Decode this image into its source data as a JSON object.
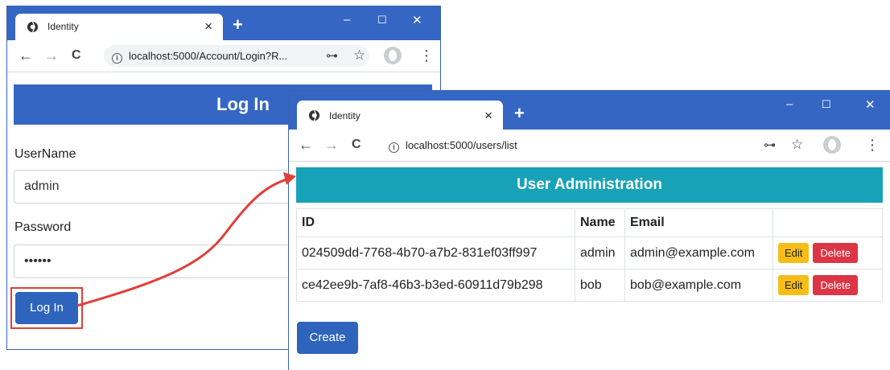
{
  "login_window": {
    "tab_title": "Identity",
    "tab_close": "×",
    "new_tab": "+",
    "address": "localhost:5000/Account/Login?R...",
    "header": "Log In",
    "username_label": "UserName",
    "username_value": "admin",
    "password_label": "Password",
    "password_value": "••••••",
    "login_button": "Log In"
  },
  "users_window": {
    "tab_title": "Identity",
    "tab_close": "×",
    "new_tab": "+",
    "address": "localhost:5000/users/list",
    "header": "User Administration",
    "table": {
      "columns": [
        "ID",
        "Name",
        "Email",
        ""
      ],
      "rows": [
        {
          "id": "024509dd-7768-4b70-a7b2-831ef03ff997",
          "name": "admin",
          "email": "admin@example.com",
          "edit": "Edit",
          "delete": "Delete"
        },
        {
          "id": "ce42ee9b-7af8-46b3-b3ed-60911d79b298",
          "name": "bob",
          "email": "bob@example.com",
          "edit": "Edit",
          "delete": "Delete"
        }
      ]
    },
    "create_button": "Create"
  },
  "icons": {
    "back": "←",
    "forward": "→",
    "reload": "C",
    "key": "⊶",
    "star": "☆",
    "menu": "⋮",
    "minimize": "–",
    "maximize": "☐",
    "close": "✕"
  },
  "colors": {
    "chrome_blue": "#3566c3",
    "primary": "#2f64bc",
    "info": "#18a2b8",
    "warning": "#f6bd16",
    "danger": "#dc3545",
    "highlight": "#e0403a"
  }
}
